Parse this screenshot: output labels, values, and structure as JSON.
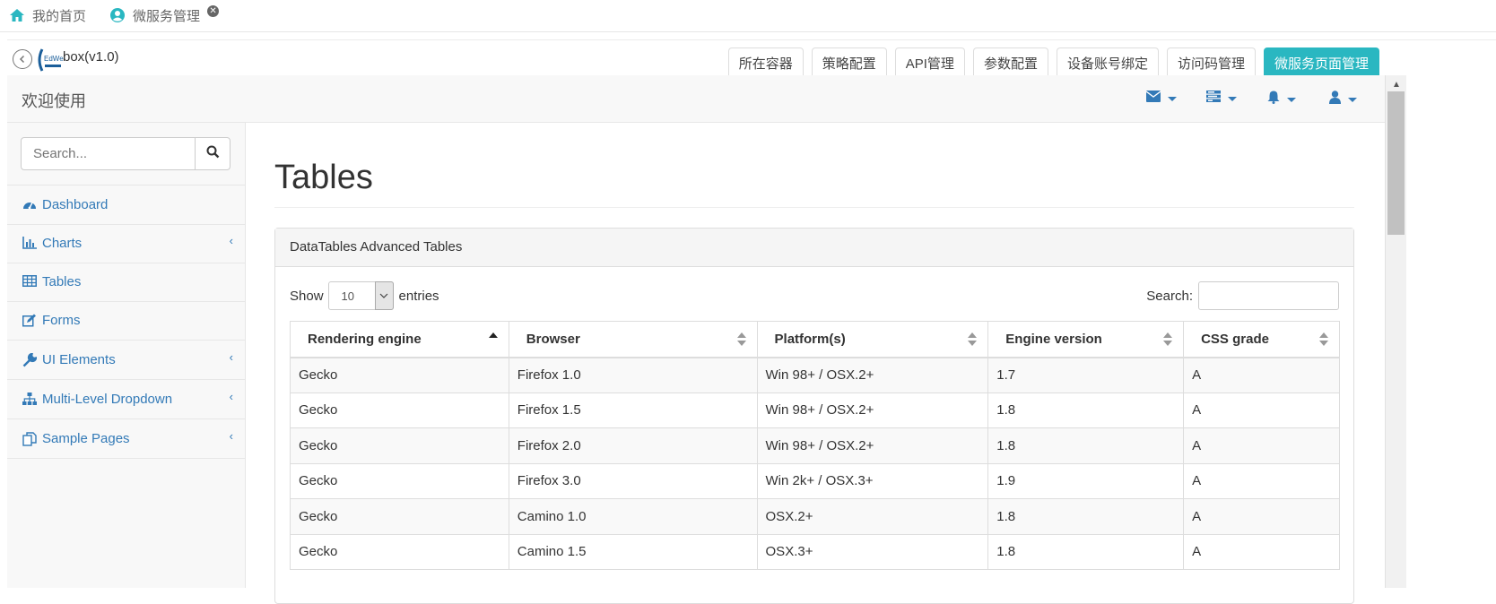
{
  "top_tabs": [
    {
      "label": "我的首页"
    },
    {
      "label": "微服务管理"
    }
  ],
  "app": {
    "logo_text": "EdWeb",
    "brand": "box(v1.0)"
  },
  "nav_tabs": [
    "所在容器",
    "策略配置",
    "API管理",
    "参数配置",
    "设备账号绑定",
    "访问码管理",
    "微服务页面管理"
  ],
  "header": {
    "welcome": "欢迎使用",
    "icons": [
      "envelope-icon",
      "tasks-icon",
      "bell-icon",
      "user-icon"
    ]
  },
  "sidebar": {
    "search_placeholder": "Search...",
    "items": [
      {
        "label": "Dashboard",
        "icon": "dashboard-icon"
      },
      {
        "label": "Charts",
        "icon": "bar-chart-icon"
      },
      {
        "label": "Tables",
        "icon": "table-icon"
      },
      {
        "label": "Forms",
        "icon": "edit-icon"
      },
      {
        "label": "UI Elements",
        "icon": "wrench-icon"
      },
      {
        "label": "Multi-Level Dropdown",
        "icon": "sitemap-icon"
      },
      {
        "label": "Sample Pages",
        "icon": "files-icon"
      }
    ]
  },
  "main": {
    "title": "Tables",
    "panel_title": "DataTables Advanced Tables",
    "show_label": "Show",
    "page_length": "10",
    "entries_label": "entries",
    "search_label": "Search:",
    "columns": [
      "Rendering engine",
      "Browser",
      "Platform(s)",
      "Engine version",
      "CSS grade"
    ],
    "rows": [
      [
        "Gecko",
        "Firefox 1.0",
        "Win 98+ / OSX.2+",
        "1.7",
        "A"
      ],
      [
        "Gecko",
        "Firefox 1.5",
        "Win 98+ / OSX.2+",
        "1.8",
        "A"
      ],
      [
        "Gecko",
        "Firefox 2.0",
        "Win 98+ / OSX.2+",
        "1.8",
        "A"
      ],
      [
        "Gecko",
        "Firefox 3.0",
        "Win 2k+ / OSX.3+",
        "1.9",
        "A"
      ],
      [
        "Gecko",
        "Camino 1.0",
        "OSX.2+",
        "1.8",
        "A"
      ],
      [
        "Gecko",
        "Camino 1.5",
        "OSX.3+",
        "1.8",
        "A"
      ]
    ]
  },
  "colors": {
    "accent": "#2ab7c1",
    "link": "#337ab7"
  }
}
